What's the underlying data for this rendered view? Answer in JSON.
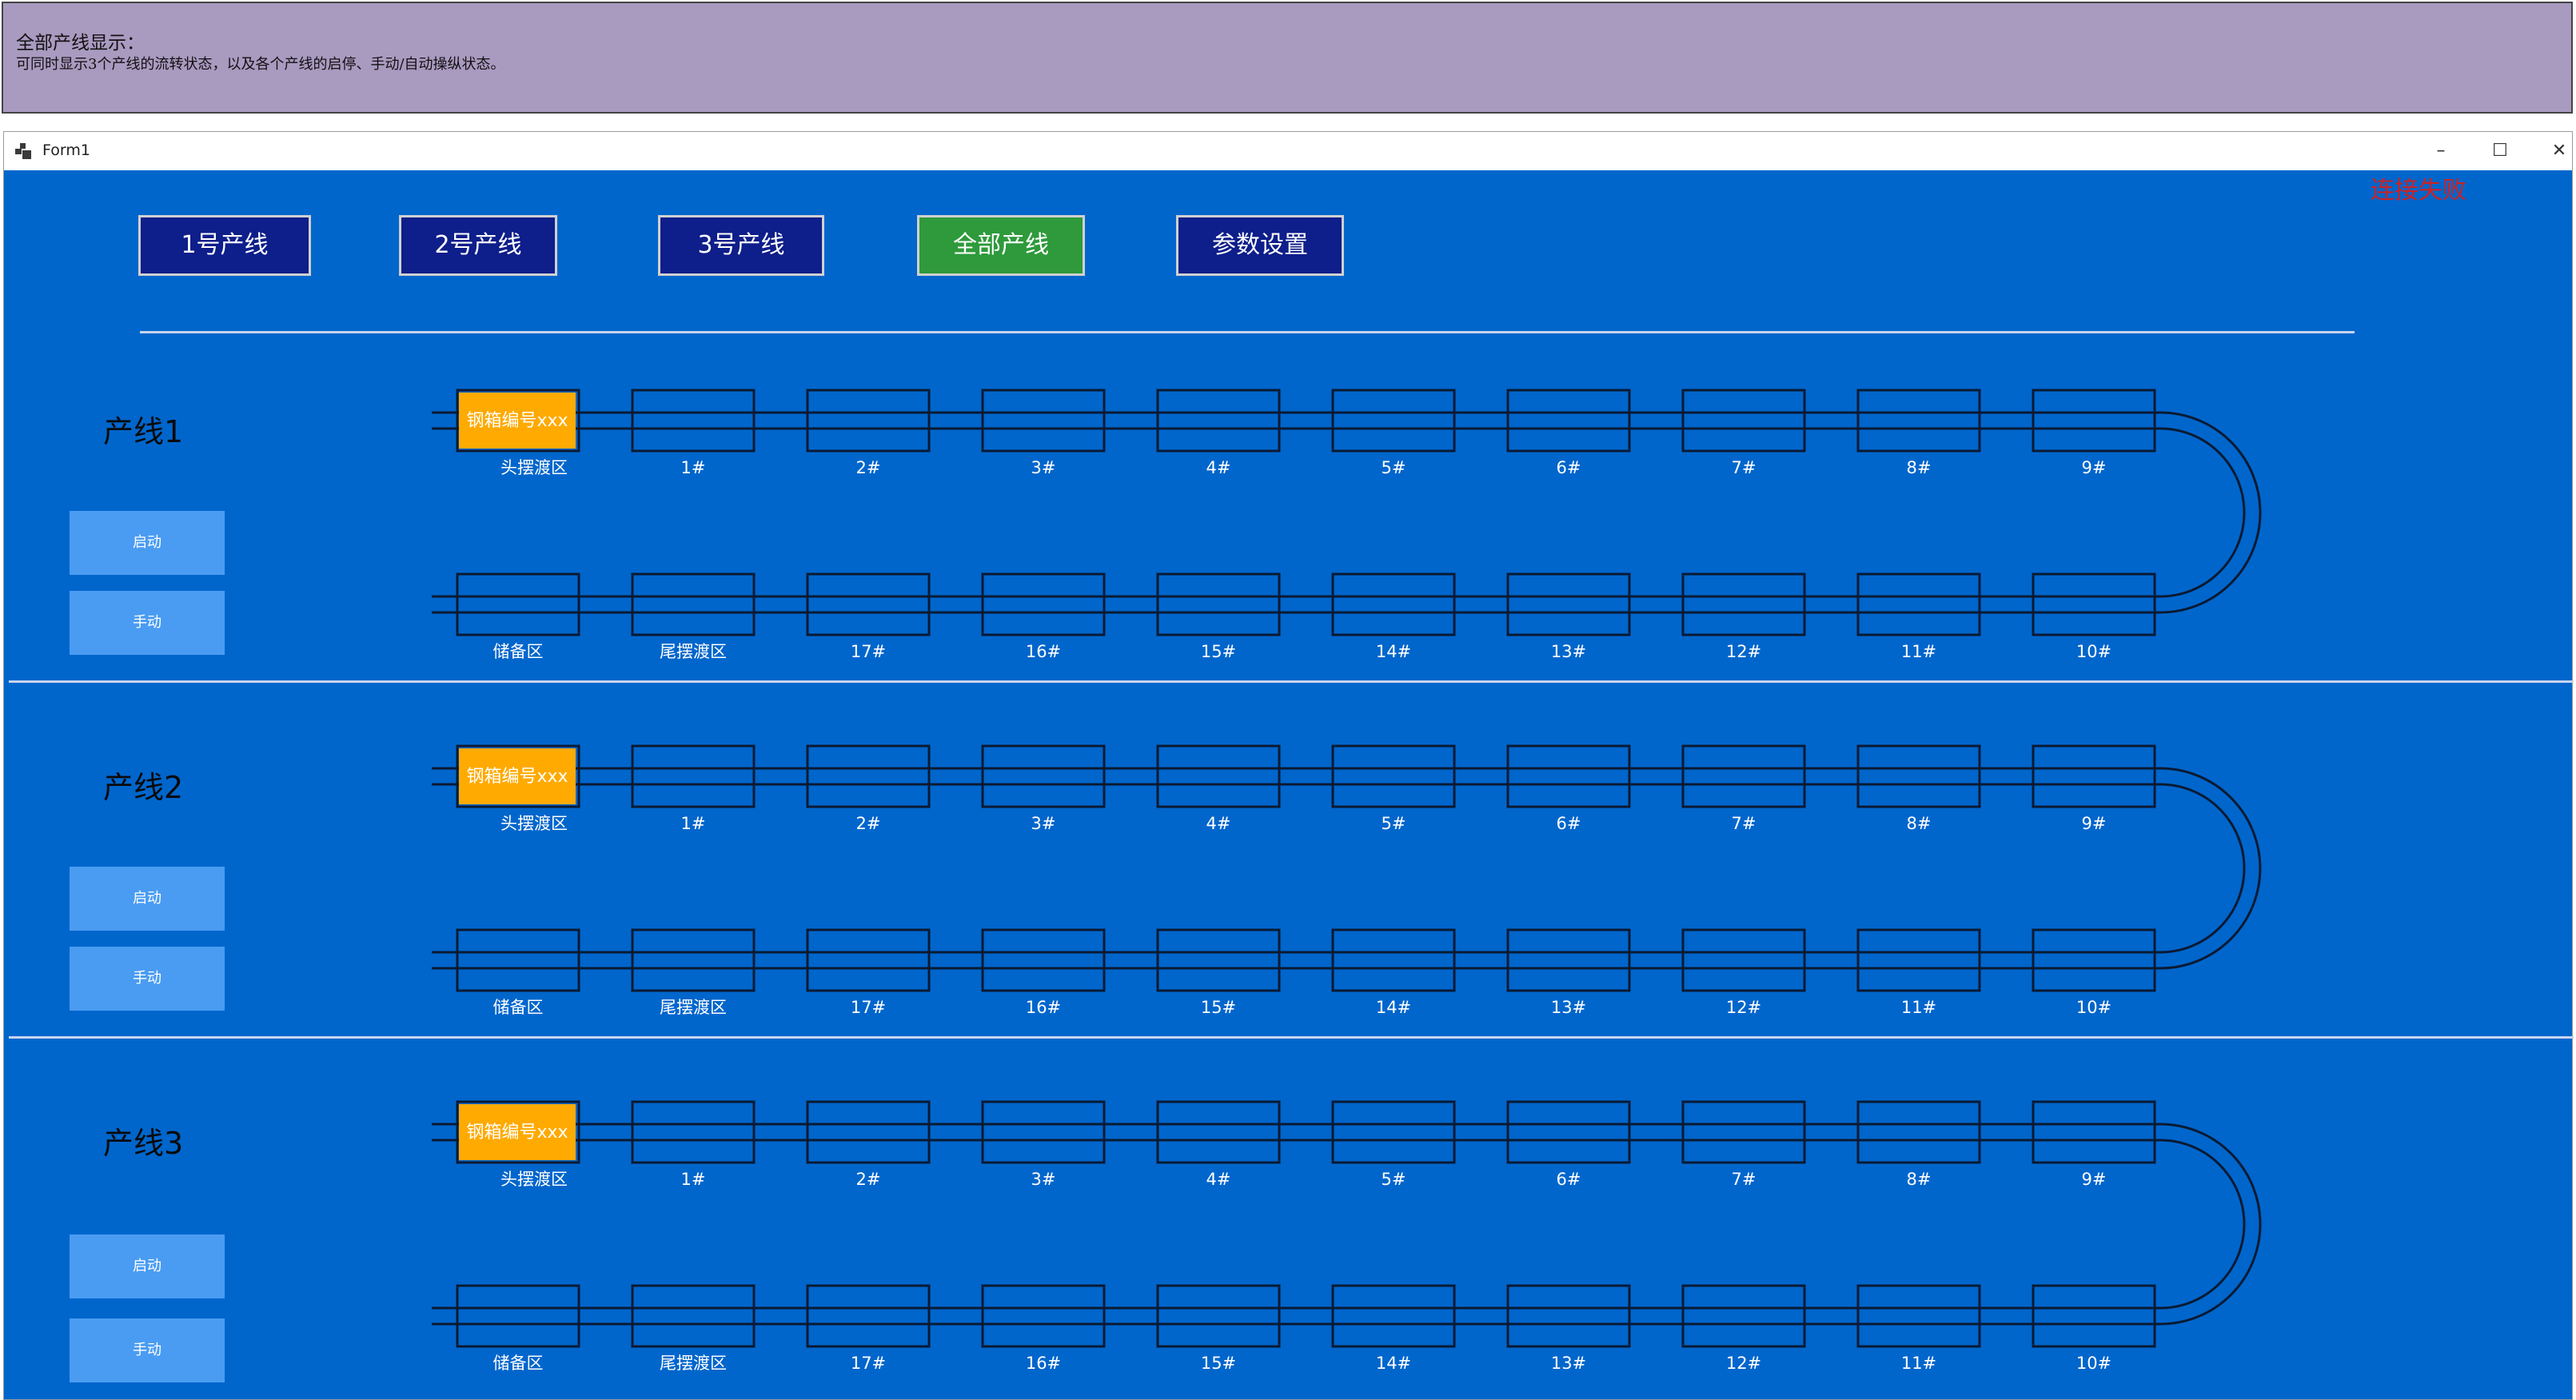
{
  "note": {
    "title": "全部产线显示：",
    "desc": "可同时显示3个产线的流转状态，以及各个产线的启停、手动/自动操纵状态。"
  },
  "window": {
    "title": "Form1",
    "controls": {
      "minimize": "–",
      "maximize": "☐",
      "close": "✕"
    },
    "status": "连接失败"
  },
  "nav": [
    "1号产线",
    "2号产线",
    "3号产线",
    "全部产线",
    "参数设置"
  ],
  "nav_active_index": 3,
  "carrier_label": "钢箱编号xxx",
  "top_stations": [
    "头摆渡区",
    "1#",
    "2#",
    "3#",
    "4#",
    "5#",
    "6#",
    "7#",
    "8#",
    "9#"
  ],
  "bottom_stations": [
    "储备区",
    "尾摆渡区",
    "17#",
    "16#",
    "15#",
    "14#",
    "13#",
    "12#",
    "11#",
    "10#"
  ],
  "lines": [
    {
      "name": "产线1",
      "start_label": "启动",
      "mode_label": "手动"
    },
    {
      "name": "产线2",
      "start_label": "启动",
      "mode_label": "手动"
    },
    {
      "name": "产线3",
      "start_label": "启动",
      "mode_label": "手动"
    }
  ],
  "colors": {
    "form_bg": "#0066cc",
    "nav_button": "#0e1e8a",
    "nav_button_active": "#2e9a3b",
    "carrier": "#ffaa00",
    "side_button": "#4a9cf2",
    "status_text": "#cc2222"
  }
}
